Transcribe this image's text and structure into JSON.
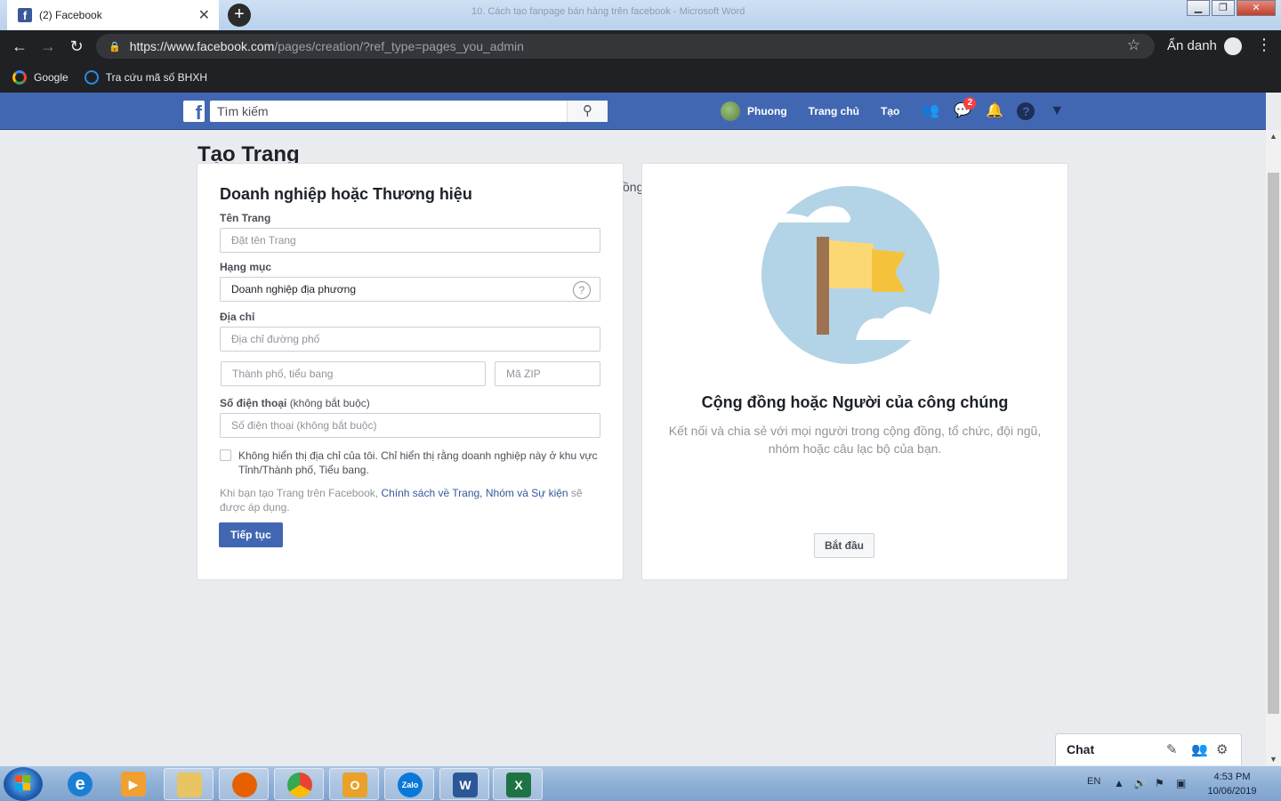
{
  "browser": {
    "tab_title": "(2) Facebook",
    "background_window_title": "10. Cách tạo fanpage bán hàng trên facebook - Microsoft Word",
    "url_host": "https://www.facebook.com",
    "url_path": "/pages/creation/?ref_type=pages_you_admin",
    "incognito_label": "Ẩn danh",
    "bookmarks": [
      {
        "label": "Google",
        "icon": "google-icon"
      },
      {
        "label": "Tra cứu mã số BHXH",
        "icon": "bhxh-icon"
      }
    ]
  },
  "fb": {
    "search_placeholder": "Tìm kiếm",
    "user_name": "Phuong",
    "home_label": "Trang chủ",
    "create_label": "Tạo",
    "messenger_badge": "2",
    "brand_color": "#4267b2"
  },
  "page": {
    "title": "Tạo Trang",
    "peek_text": "ồng"
  },
  "business_form": {
    "heading": "Doanh nghiệp hoặc Thương hiệu",
    "page_name_label": "Tên Trang",
    "page_name_placeholder": "Đặt tên Trang",
    "category_label": "Hạng mục",
    "category_value": "Doanh nghiệp địa phương",
    "address_label": "Địa chỉ",
    "street_placeholder": "Địa chỉ đường phố",
    "city_placeholder": "Thành phố, tiểu bang",
    "zip_placeholder": "Mã ZIP",
    "phone_label": "Số điện thoại",
    "phone_optional": "(không bắt buộc)",
    "phone_placeholder": "Số điện thoại (không bắt buộc)",
    "hide_address_text": "Không hiển thị địa chỉ của tôi. Chỉ hiển thị rằng doanh nghiệp này ở khu vực Tỉnh/Thành phố, Tiểu bang.",
    "policy_prefix": "Khi bạn tạo Trang trên Facebook, ",
    "policy_link": "Chính sách về Trang, Nhóm và Sự kiện",
    "policy_suffix": " sẽ được áp dụng.",
    "continue_label": "Tiếp tục"
  },
  "community_card": {
    "heading": "Cộng đồng hoặc Người của công chúng",
    "description": "Kết nối và chia sẻ với mọi người trong cộng đồng, tổ chức, đội ngũ, nhóm hoặc câu lạc bộ của bạn.",
    "start_label": "Bắt đầu"
  },
  "chat": {
    "label": "Chat"
  },
  "taskbar": {
    "language": "EN",
    "time": "4:53 PM",
    "date": "10/06/2019",
    "apps": [
      {
        "name": "internet-explorer-icon"
      },
      {
        "name": "media-player-icon"
      },
      {
        "name": "file-explorer-icon"
      },
      {
        "name": "firefox-icon"
      },
      {
        "name": "chrome-icon"
      },
      {
        "name": "outlook-icon",
        "label": "O"
      },
      {
        "name": "zalo-icon",
        "label": "Zalo"
      },
      {
        "name": "word-icon",
        "label": "W"
      },
      {
        "name": "excel-icon",
        "label": "X"
      }
    ]
  }
}
